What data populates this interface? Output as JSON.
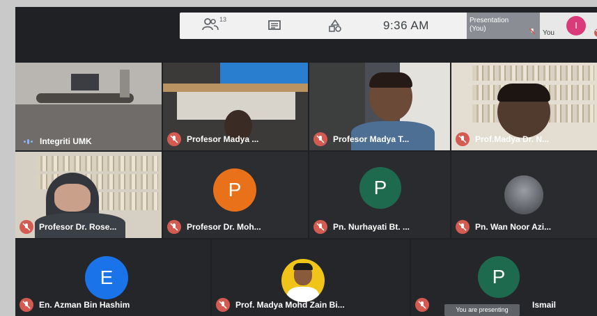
{
  "topbar": {
    "participants_count": "13",
    "time": "9:36 AM",
    "presentation_line1": "Presentation",
    "presentation_line2": "(You)",
    "you_label": "You",
    "you_initial": "I"
  },
  "tiles": [
    {
      "name": "Integriti UMK",
      "speaking": true
    },
    {
      "name": "Profesor Madya ..."
    },
    {
      "name": "Profesor Madya T..."
    },
    {
      "name": "Prof.Madya Dr. N..."
    },
    {
      "name": "Profesor Dr. Rose..."
    },
    {
      "name": "Profesor Dr. Moh...",
      "initial": "P",
      "color": "#e8711a"
    },
    {
      "name": "Pn. Nurhayati Bt. ...",
      "initial": "P",
      "color": "#1e6a4f"
    },
    {
      "name": "Pn. Wan Noor Azi..."
    },
    {
      "name": "En. Azman Bin Hashim",
      "initial": "E",
      "color": "#1a73e8"
    },
    {
      "name": "Prof. Madya Mohd Zain Bi..."
    },
    {
      "name": "Ismail",
      "initial": "P",
      "color": "#1e6a4f"
    }
  ],
  "toast": "You are presenting",
  "colors": {
    "mic_off": "#d45b52",
    "background": "#202124"
  }
}
